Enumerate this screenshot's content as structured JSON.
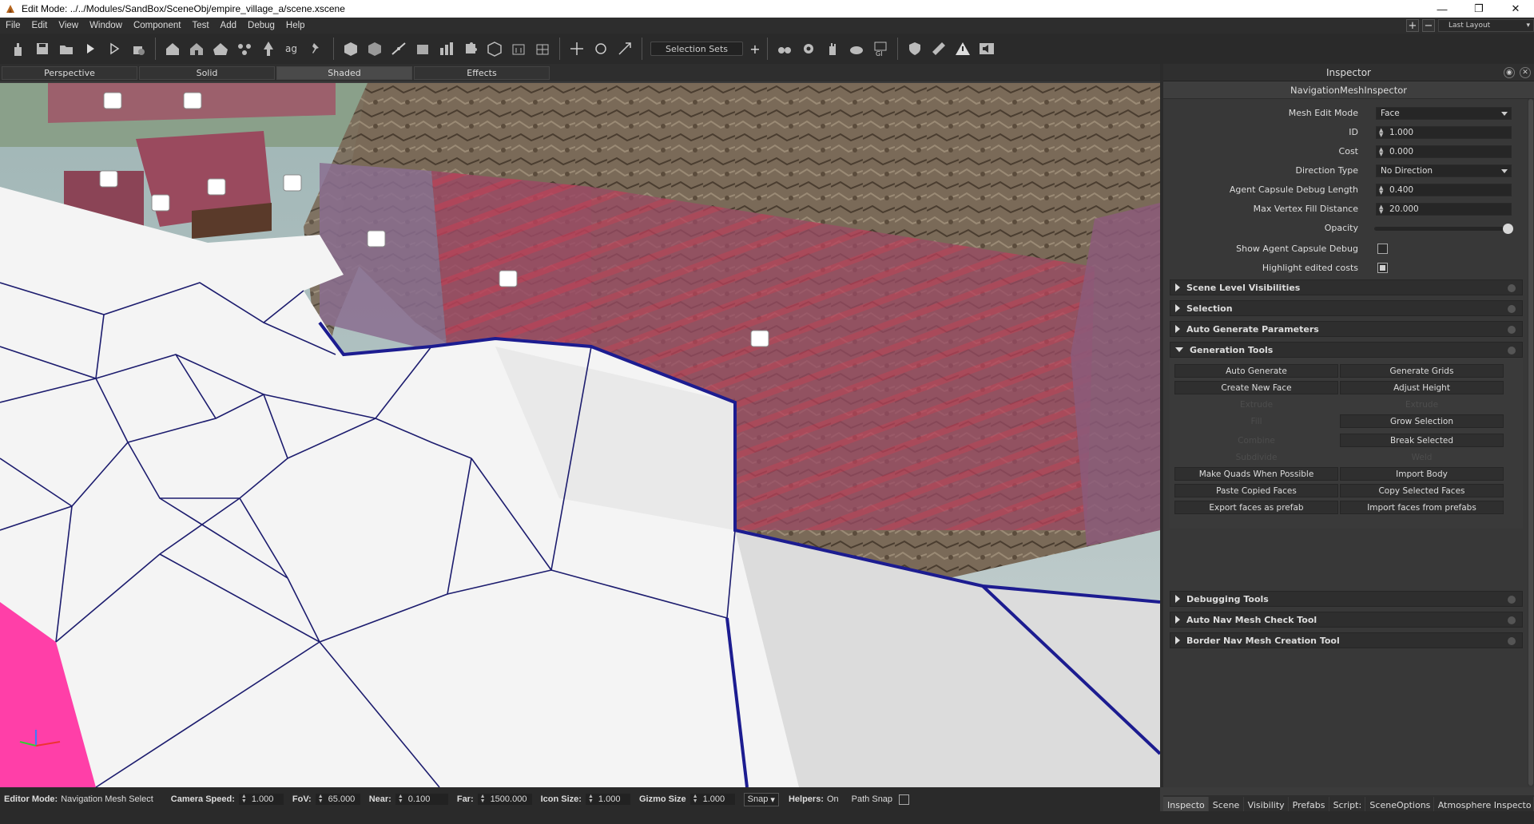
{
  "window": {
    "title": "Edit Mode: ../../Modules/SandBox/SceneObj/empire_village_a/scene.xscene",
    "minimize": "—",
    "restore": "❐",
    "close": "✕"
  },
  "menu": [
    "File",
    "Edit",
    "View",
    "Window",
    "Component",
    "Test",
    "Add",
    "Debug",
    "Help"
  ],
  "layout": {
    "add": "+",
    "remove": "−",
    "current": "Last Layout"
  },
  "toolbar": {
    "selection_sets": "Selection Sets",
    "add_set": "+"
  },
  "viewport_tabs": [
    "Perspective",
    "Solid",
    "Shaded",
    "Effects"
  ],
  "active_viewport_tab": "Shaded",
  "inspector": {
    "title": "Inspector",
    "component": "NavigationMeshInspector",
    "properties": [
      {
        "label": "Mesh Edit Mode",
        "type": "dropdown",
        "value": "Face"
      },
      {
        "label": "ID",
        "type": "number",
        "value": "1.000"
      },
      {
        "label": "Cost",
        "type": "number",
        "value": "0.000"
      },
      {
        "label": "Direction Type",
        "type": "dropdown",
        "value": "No Direction"
      },
      {
        "label": "Agent Capsule Debug Length",
        "type": "number",
        "value": "0.400"
      },
      {
        "label": "Max Vertex Fill Distance",
        "type": "number",
        "value": "20.000"
      },
      {
        "label": "Opacity",
        "type": "slider",
        "value": 1.0
      },
      {
        "label": "Show Agent Capsule Debug",
        "type": "checkbox",
        "value": false
      },
      {
        "label": "Highlight edited costs",
        "type": "checkbox",
        "value": true
      }
    ],
    "sections_top": [
      "Scene Level Visibilities",
      "Selection",
      "Auto Generate Parameters"
    ],
    "generation_tools": {
      "title": "Generation Tools",
      "buttons": [
        {
          "label": "Auto Generate",
          "enabled": true
        },
        {
          "label": "Generate Grids",
          "enabled": true
        },
        {
          "label": "Create New Face",
          "enabled": true
        },
        {
          "label": "Adjust Height",
          "enabled": true
        },
        {
          "label": "Extrude",
          "enabled": false
        },
        {
          "label": "Extrude",
          "enabled": false
        },
        {
          "label": "Fill",
          "enabled": false
        },
        {
          "label": "Grow Selection",
          "enabled": true
        },
        {
          "label": "Combine",
          "enabled": false
        },
        {
          "label": "Break Selected",
          "enabled": true
        },
        {
          "label": "Subdivide",
          "enabled": false
        },
        {
          "label": "Weld",
          "enabled": false
        },
        {
          "label": "Make Quads When Possible",
          "enabled": true
        },
        {
          "label": "Import Body",
          "enabled": true
        },
        {
          "label": "Paste Copied Faces",
          "enabled": true
        },
        {
          "label": "Copy Selected Faces",
          "enabled": true
        },
        {
          "label": "Export faces as prefab",
          "enabled": true
        },
        {
          "label": "Import faces from prefabs",
          "enabled": true
        }
      ]
    },
    "sections_bottom": [
      "Debugging Tools",
      "Auto Nav Mesh Check Tool",
      "Border Nav Mesh Creation Tool"
    ]
  },
  "statusbar": {
    "editor_mode_label": "Editor Mode:",
    "editor_mode_value": "Navigation Mesh Select",
    "camera_speed_label": "Camera Speed:",
    "camera_speed": "1.000",
    "fov_label": "FoV:",
    "fov": "65.000",
    "near_label": "Near:",
    "near": "0.100",
    "far_label": "Far:",
    "far": "1500.000",
    "icon_size_label": "Icon Size:",
    "icon_size": "1.000",
    "gizmo_size_label": "Gizmo Size",
    "gizmo_size": "1.000",
    "snap": "Snap",
    "helpers_label": "Helpers:",
    "helpers_value": "On",
    "path_snap_label": "Path Snap"
  },
  "bottom_tabs": [
    "Inspecto",
    "Scene",
    "Visibility",
    "Prefabs",
    "Script:",
    "SceneOptions",
    "Atmosphere Inspecto"
  ],
  "active_bottom_tab": "Inspecto",
  "colors": {
    "navmesh_face": "#ffffff",
    "navmesh_edge": "#1a1a6e",
    "selected_face": "#ff3fa8",
    "cost_wall": "#a0506a",
    "panel_bg": "#383838"
  }
}
